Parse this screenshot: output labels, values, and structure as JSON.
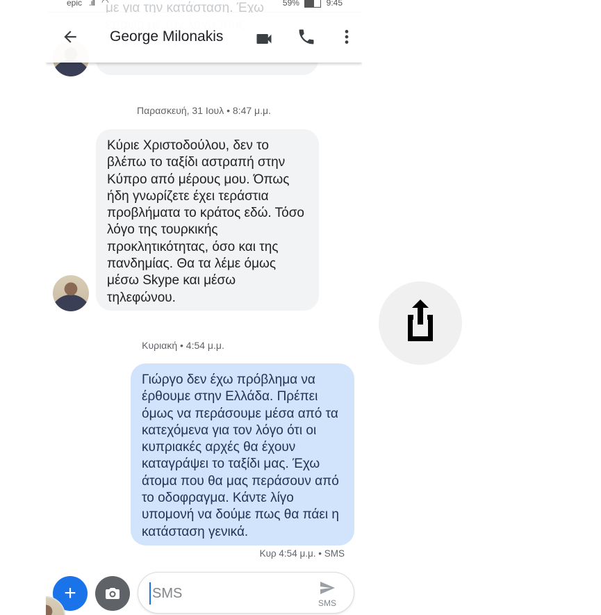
{
  "status_bar": {
    "carrier": "epic",
    "battery": "59%",
    "time": "9:45"
  },
  "app_bar": {
    "title": "George Milonakis"
  },
  "ghost_text": "με για την κατάσταση. Έχω\nεπαφή με τον λόγο τους\nΑνωτέρους μου.",
  "messages": [
    {
      "timestamp": "Παρασκευή, 31 Ιουλ • 8:47 μ.μ.",
      "direction": "incoming",
      "text": "Κύριε Χριστοδούλου, δεν το βλέπω το ταξίδι αστραπή στην Κύπρο από μέρους μου. Όπως ήδη γνωρίζετε έχει τεράστια προβλήματα το κράτος εδώ. Τόσο λόγο της τουρκικής προκλητικότητας, όσο και της πανδημίας. Θα τα λέμε όμως μέσω Skype και μέσω τηλεφώνου."
    },
    {
      "timestamp": "Κυριακή • 4:54 μ.μ.",
      "direction": "outgoing",
      "text": "Γιώργο δεν έχω πρόβλημα να έρθουμε στην Ελλάδα. Πρέπει όμως να περάσουμε μέσα από τα κατεχόμενα για τον λόγο ότι οι κυπριακές αρχές θα έχουν καταγράψει το ταξίδι μας. Έχω άτομα που θα μας περάσουν από το οδοφραγμα. Κάντε λίγο υπομονή να δούμε πως θα πάει η κατάσταση γενικά.",
      "meta": "Κυρ 4:54 μ.μ. • SMS"
    }
  ],
  "compose": {
    "plus": "+",
    "placeholder": "SMS",
    "send_label": "SMS"
  },
  "colors": {
    "accent": "#1a73e8",
    "incoming_bubble": "#f1f3f4",
    "outgoing_bubble": "#d2e3fc"
  }
}
